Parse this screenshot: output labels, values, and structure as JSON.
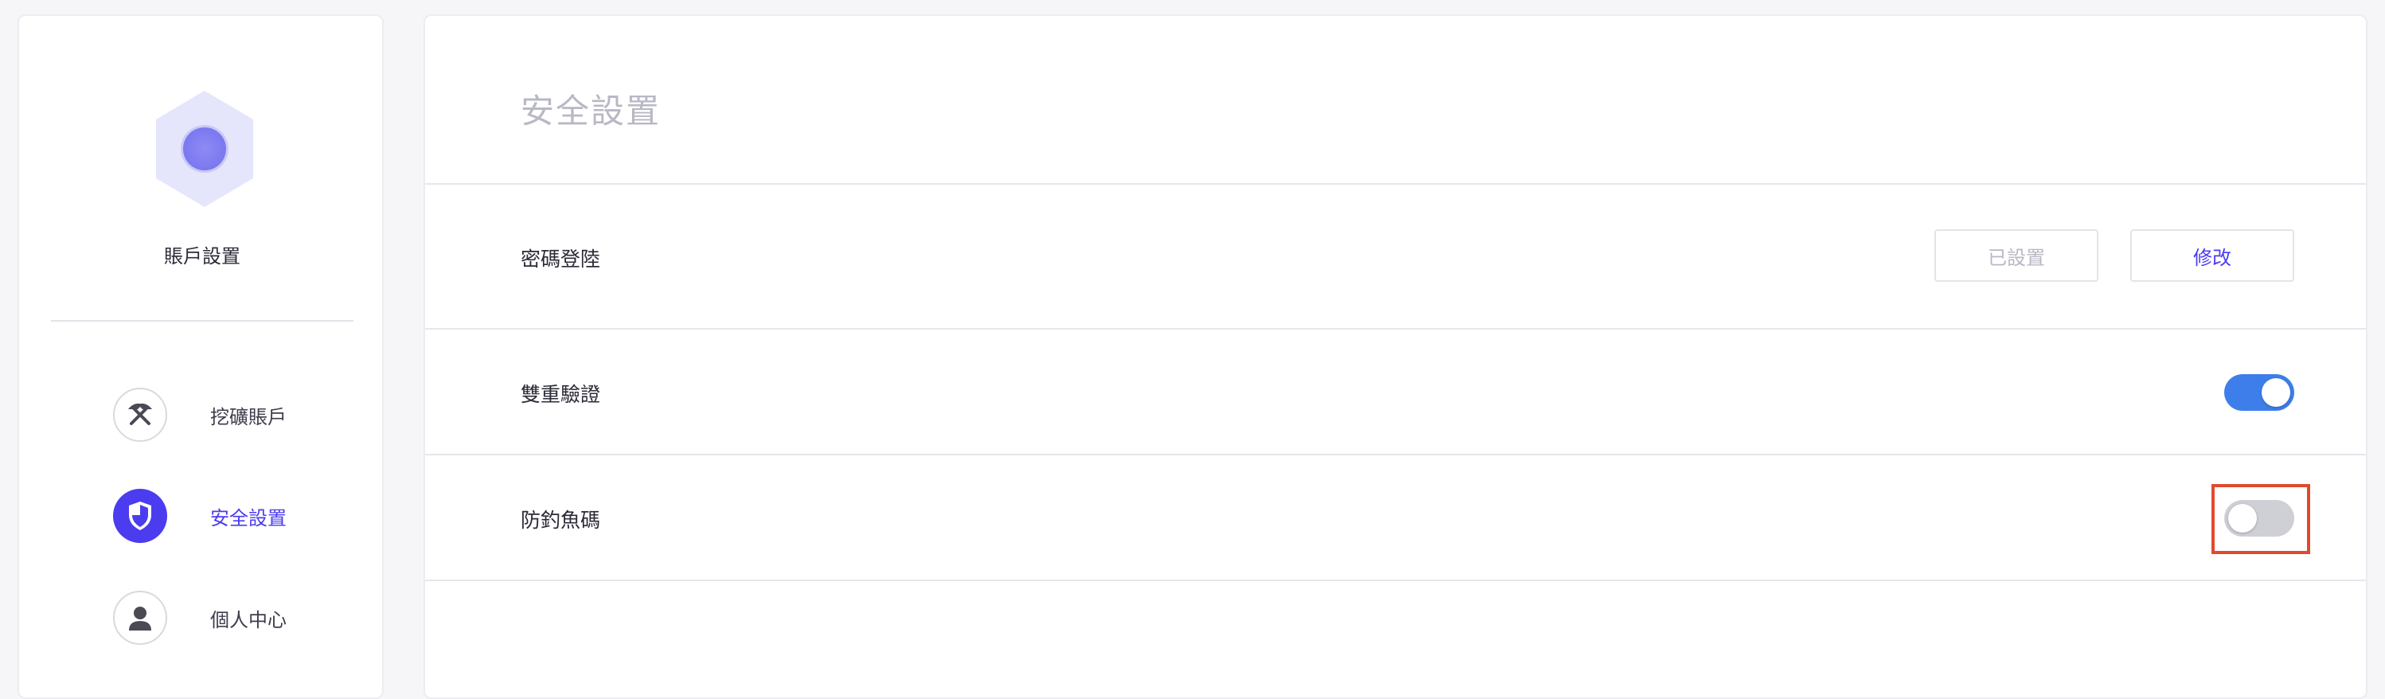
{
  "sidebar": {
    "account_title": "賬戶設置",
    "avatar_icon": "hexagon-avatar-icon",
    "items": [
      {
        "label": "挖礦賬戶",
        "icon": "pickaxe-icon",
        "active": false
      },
      {
        "label": "安全設置",
        "icon": "shield-icon",
        "active": true
      },
      {
        "label": "個人中心",
        "icon": "user-icon",
        "active": false
      }
    ]
  },
  "main": {
    "title": "安全設置",
    "rows": [
      {
        "label": "密碼登陸",
        "status_button": "已設置",
        "action_button": "修改"
      },
      {
        "label": "雙重驗證",
        "toggle_on": true
      },
      {
        "label": "防釣魚碼",
        "toggle_on": false
      }
    ]
  },
  "colors": {
    "accent": "#4b3cf0",
    "toggle_on": "#3d7eeb",
    "toggle_off": "#cfcfd6",
    "highlight": "#e04a2f"
  }
}
